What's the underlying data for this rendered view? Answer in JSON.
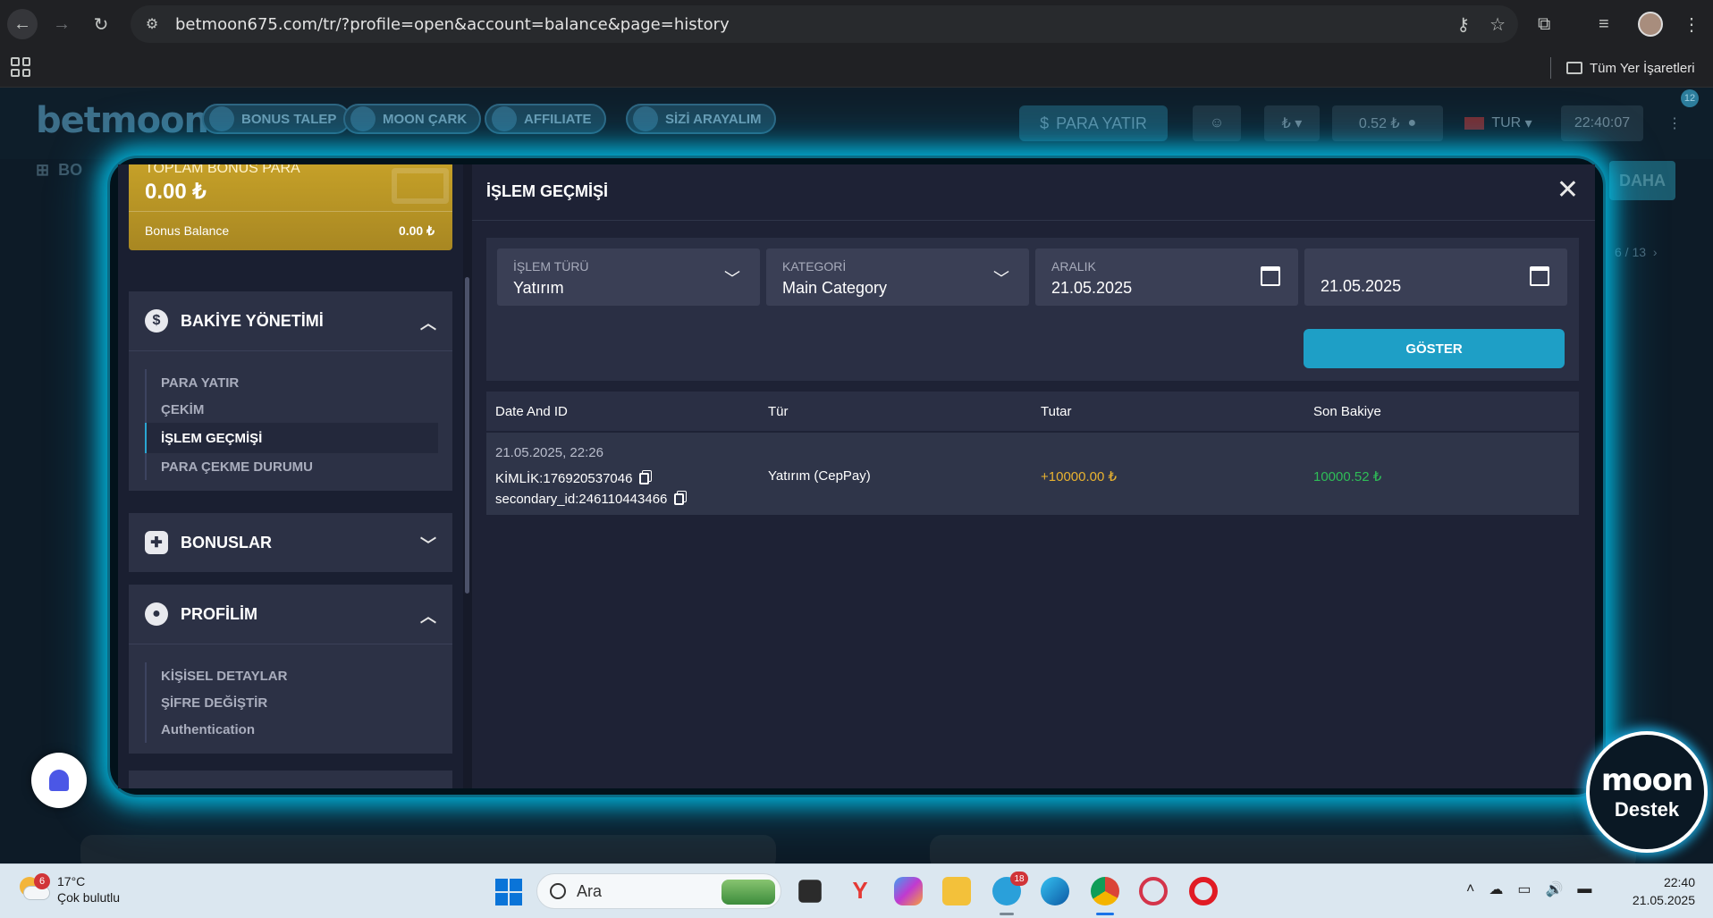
{
  "browser": {
    "url": "betmoon675.com/tr/?profile=open&account=balance&page=history",
    "bookmarks_all": "Tüm Yer İşaretleri"
  },
  "site": {
    "logo": "betmoon",
    "nav_pills": [
      "BONUS TALEP",
      "MOON ÇARK",
      "AFFILIATE",
      "SİZİ ARAYALIM"
    ],
    "deposit_button": "PARA YATIR",
    "balance": "0.52 ₺",
    "language": "TUR",
    "time": "22:40:07",
    "notification_count": "12",
    "sub_nav_left": "BO",
    "more_button": "DAHA",
    "pager": "6 / 13"
  },
  "sidebar": {
    "bonus_card": {
      "title": "TOPLAM BONUS PARA",
      "amount": "0.00 ₺",
      "balance_label": "Bonus Balance",
      "balance_value": "0.00 ₺"
    },
    "balance_section": {
      "title": "BAKİYE YÖNETİMİ",
      "items": [
        "PARA YATIR",
        "ÇEKİM",
        "İŞLEM GEÇMİŞİ",
        "PARA ÇEKME DURUMU"
      ]
    },
    "bonus_section": {
      "title": "BONUSLAR"
    },
    "profile_section": {
      "title": "PROFİLİM",
      "items": [
        "KİŞİSEL DETAYLAR",
        "ŞİFRE DEĞİŞTİR",
        "Authentication"
      ]
    }
  },
  "history": {
    "title": "İŞLEM GEÇMİŞİ",
    "filters": {
      "type_label": "İŞLEM TÜRÜ",
      "type_value": "Yatırım",
      "category_label": "KATEGORİ",
      "category_value": "Main Category",
      "range_label": "ARALIK",
      "range_start": "21.05.2025",
      "range_end": "21.05.2025"
    },
    "show_button": "GÖSTER",
    "columns": [
      "Date And ID",
      "Tür",
      "Tutar",
      "Son Bakiye"
    ],
    "rows": [
      {
        "date": "21.05.2025, 22:26",
        "id": "KİMLİK:176920537046",
        "secondary_id": "secondary_id:246110443466",
        "type": "Yatırım (CepPay)",
        "amount": "+10000.00 ₺",
        "balance": "10000.52 ₺"
      }
    ]
  },
  "support": {
    "brand": "moon",
    "label": "Destek"
  },
  "taskbar": {
    "weather_badge": "6",
    "temperature": "17°C",
    "weather_desc": "Çok bulutlu",
    "search_placeholder": "Ara",
    "telegram_badge": "18",
    "clock_time": "22:40",
    "clock_date": "21.05.2025"
  },
  "colors": {
    "accent": "#1e9fc6",
    "amount": "#e8b230",
    "balance": "#2fbc57",
    "bonus_gold": "#c5a028"
  }
}
